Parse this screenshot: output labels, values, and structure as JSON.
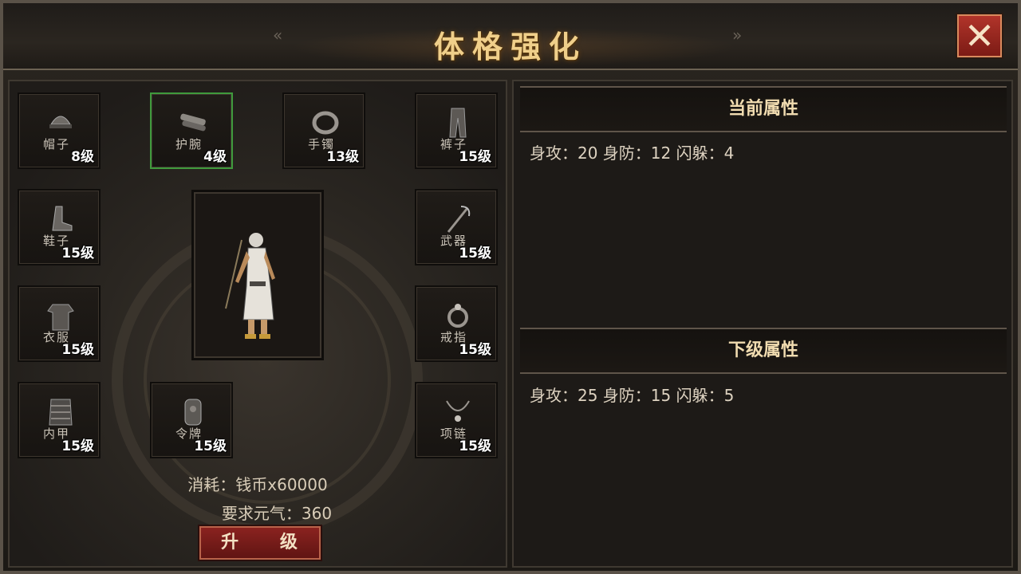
{
  "window": {
    "title": "体格强化",
    "close_label": "✕"
  },
  "equipment_slots": [
    {
      "id": "hat",
      "name": "帽子",
      "level": "8级"
    },
    {
      "id": "wrist",
      "name": "护腕",
      "level": "4级",
      "selected": true
    },
    {
      "id": "bracelet",
      "name": "手镯",
      "level": "13级"
    },
    {
      "id": "pants",
      "name": "裤子",
      "level": "15级"
    },
    {
      "id": "shoes",
      "name": "鞋子",
      "level": "15级"
    },
    {
      "id": "weapon",
      "name": "武器",
      "level": "15级"
    },
    {
      "id": "clothes",
      "name": "衣服",
      "level": "15级"
    },
    {
      "id": "ring",
      "name": "戒指",
      "level": "15级"
    },
    {
      "id": "armor",
      "name": "内甲",
      "level": "15级"
    },
    {
      "id": "token",
      "name": "令牌",
      "level": "15级"
    },
    {
      "id": "necklace",
      "name": "项链",
      "level": "15级"
    }
  ],
  "cost": {
    "consume": "消耗：钱币x60000",
    "requirement": "要求元气：360"
  },
  "upgrade_button": "升 级",
  "current": {
    "header": "当前属性",
    "stats": "身攻：20 身防：12 闪躲：4"
  },
  "next": {
    "header": "下级属性",
    "stats": "身攻：25 身防：15 闪躲：5"
  },
  "colors": {
    "title_gold": "#f0cf8a",
    "selected_border": "#3f9a3c",
    "button_red": "#8c2320"
  }
}
